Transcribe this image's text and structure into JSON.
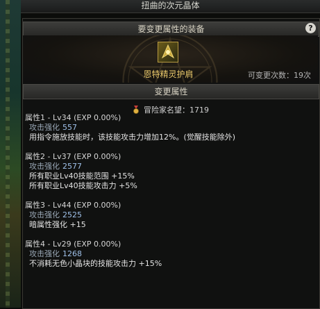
{
  "window": {
    "title": "扭曲的次元晶体"
  },
  "equip_section": {
    "header": "要变更属性的装备",
    "help": "?"
  },
  "item": {
    "name": "恩特精灵护肩",
    "change_count": "可变更次数：19次"
  },
  "change_section": {
    "header": "变更属性"
  },
  "adventure": {
    "label": "冒险家名望：1719"
  },
  "attributes": [
    {
      "title": "属性1 - Lv34 (EXP 0.00%)",
      "stat_key": "攻击强化",
      "stat_val": "557",
      "effects": [
        "用指令施放技能时，该技能攻击力增加12%。(觉醒技能除外)"
      ]
    },
    {
      "title": "属性2 - Lv37 (EXP 0.00%)",
      "stat_key": "攻击强化",
      "stat_val": "2577",
      "effects": [
        "所有职业Lv40技能范围 +15%",
        "所有职业Lv40技能攻击力 +5%"
      ]
    },
    {
      "title": "属性3 - Lv44 (EXP 0.00%)",
      "stat_key": "攻击强化",
      "stat_val": "2525",
      "effects": [
        "暗属性强化 +15"
      ]
    },
    {
      "title": "属性4 - Lv29 (EXP 0.00%)",
      "stat_key": "攻击强化",
      "stat_val": "1268",
      "effects": [
        "不消耗无色小晶块的技能攻击力 +15%"
      ]
    }
  ]
}
